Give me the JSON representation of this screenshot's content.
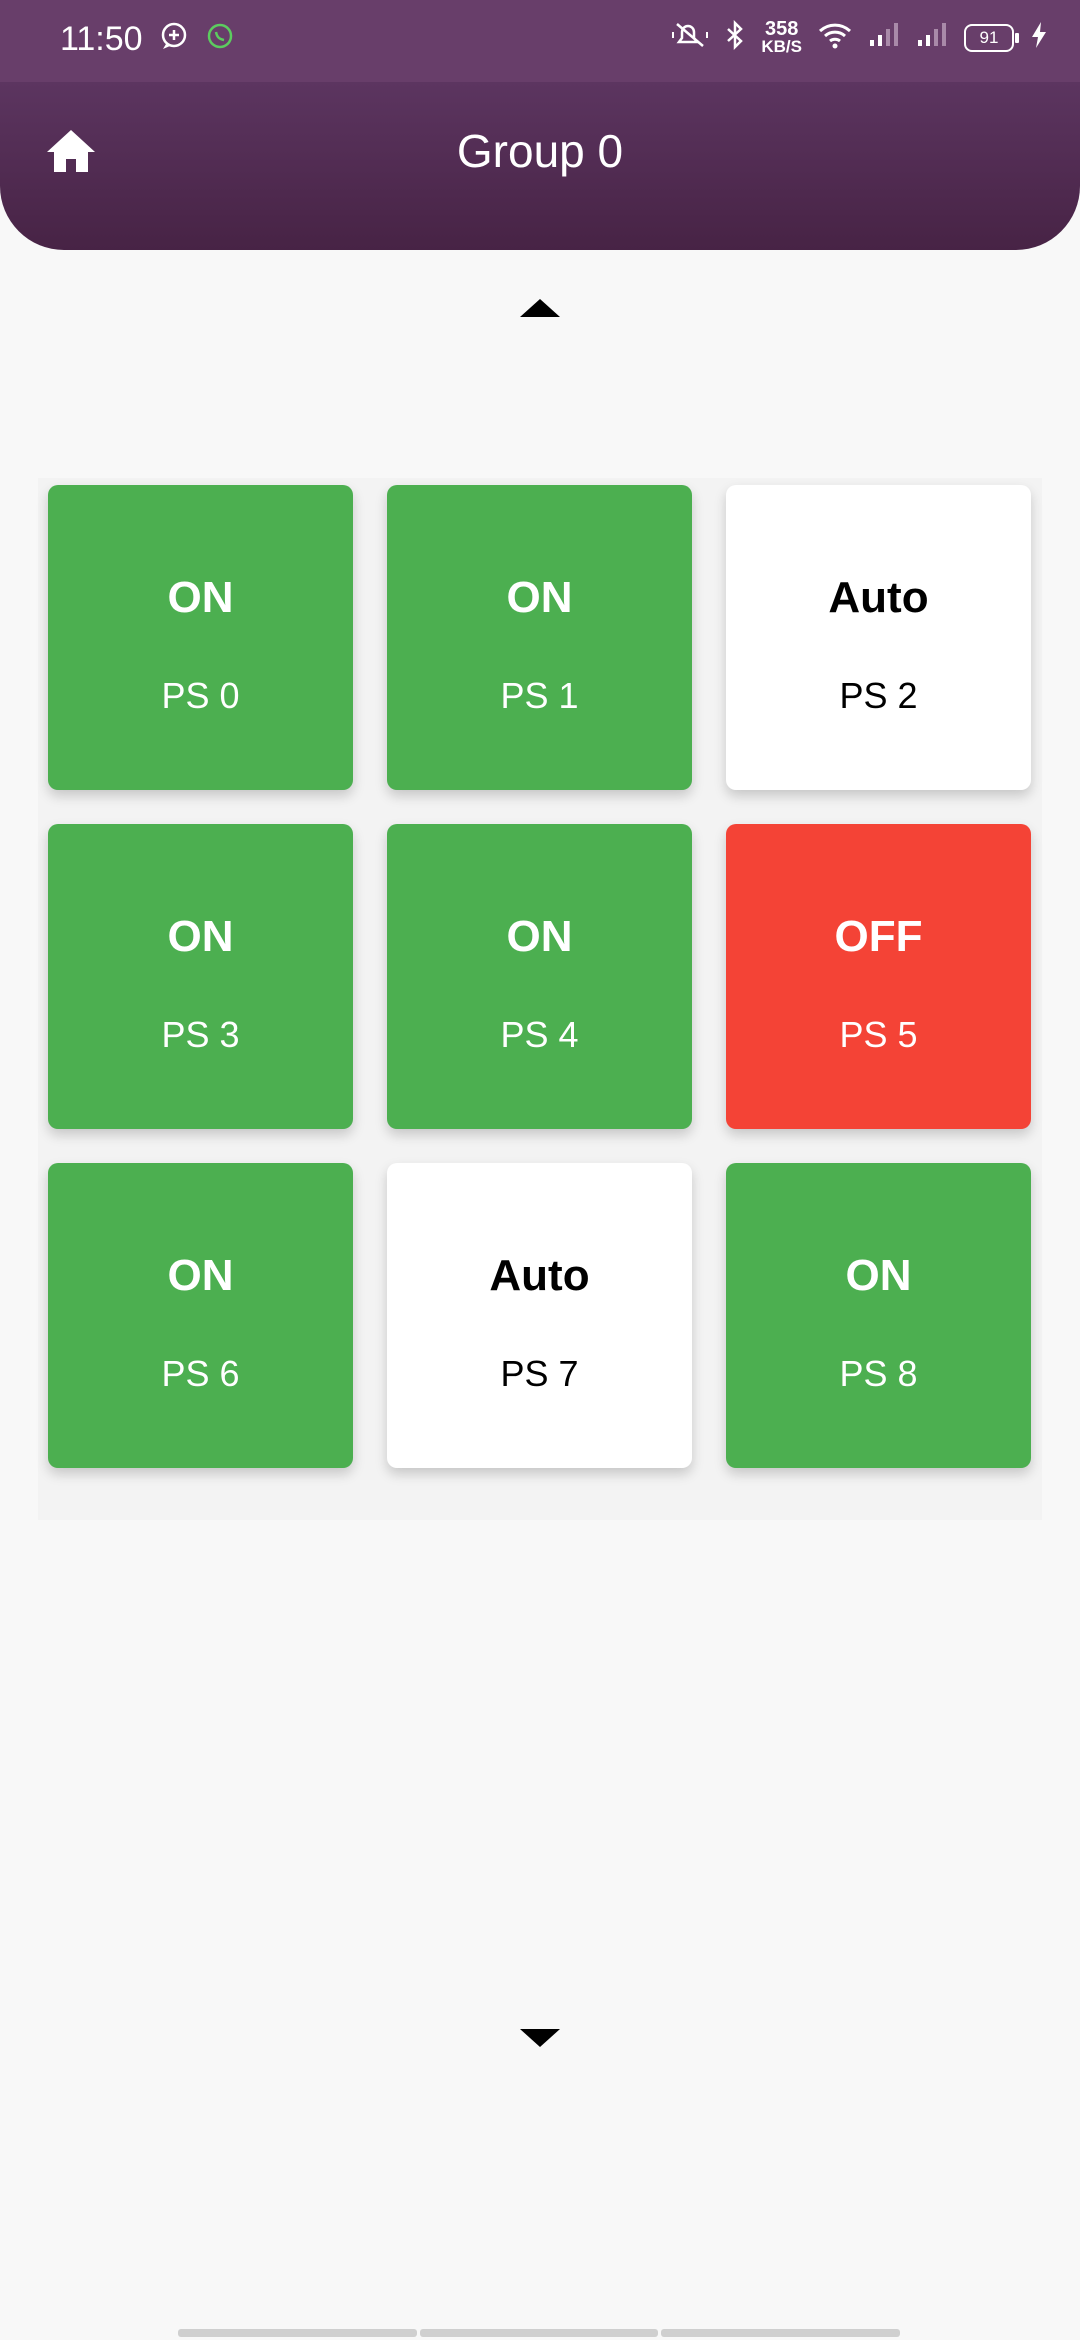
{
  "status_bar": {
    "time": "11:50",
    "net_speed_value": "358",
    "net_speed_unit": "KB/S",
    "battery": "91",
    "icons": [
      "chat-bubble-icon",
      "whatsapp-icon",
      "mute-icon",
      "bluetooth-icon",
      "wifi-icon",
      "signal-icon",
      "signal-icon",
      "charging-icon"
    ]
  },
  "app_bar": {
    "title": "Group 0",
    "home_icon": "home-icon"
  },
  "tiles": [
    {
      "state": "ON",
      "label": "PS 0",
      "color": "#4caf50"
    },
    {
      "state": "ON",
      "label": "PS 1",
      "color": "#4caf50"
    },
    {
      "state": "Auto",
      "label": "PS 2",
      "color": "#ffffff"
    },
    {
      "state": "ON",
      "label": "PS 3",
      "color": "#4caf50"
    },
    {
      "state": "ON",
      "label": "PS 4",
      "color": "#4caf50"
    },
    {
      "state": "OFF",
      "label": "PS 5",
      "color": "#f44336"
    },
    {
      "state": "ON",
      "label": "PS 6",
      "color": "#4caf50"
    },
    {
      "state": "Auto",
      "label": "PS 7",
      "color": "#ffffff"
    },
    {
      "state": "ON",
      "label": "PS 8",
      "color": "#4caf50"
    }
  ],
  "colors": {
    "status_bar": "#683e6a",
    "app_bar": "#52304f",
    "on": "#4caf50",
    "off": "#f44336",
    "auto": "#ffffff",
    "background": "#f8f8f8"
  }
}
